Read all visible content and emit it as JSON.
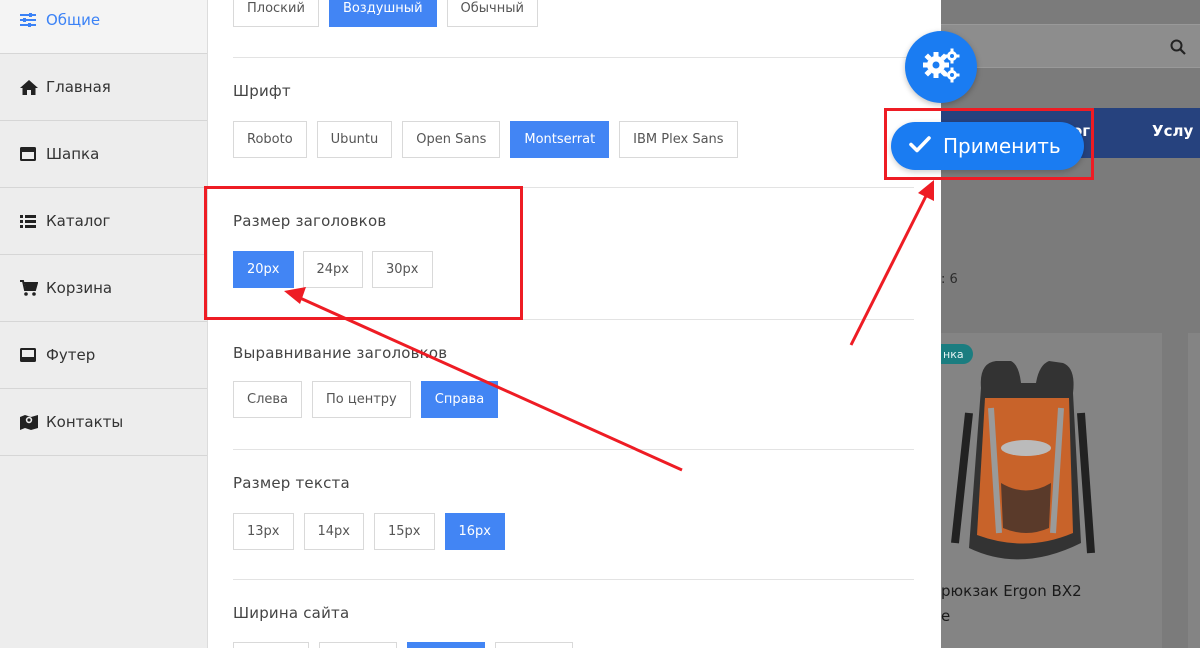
{
  "sidebar": {
    "items": [
      {
        "label": "Общие",
        "icon": "sliders-icon",
        "active": true
      },
      {
        "label": "Главная",
        "icon": "home-icon"
      },
      {
        "label": "Шапка",
        "icon": "header-icon"
      },
      {
        "label": "Каталог",
        "icon": "list-icon"
      },
      {
        "label": "Корзина",
        "icon": "cart-icon"
      },
      {
        "label": "Футер",
        "icon": "footer-icon"
      },
      {
        "label": "Контакты",
        "icon": "map-icon"
      }
    ]
  },
  "panel": {
    "style_options": [
      "Плоский",
      "Воздушный",
      "Обычный"
    ],
    "style_selected": "Воздушный",
    "font": {
      "label": "Шрифт",
      "options": [
        "Roboto",
        "Ubuntu",
        "Open Sans",
        "Montserrat",
        "IBM Plex Sans"
      ],
      "selected": "Montserrat"
    },
    "heading_size": {
      "label": "Размер заголовков",
      "options": [
        "20px",
        "24px",
        "30px"
      ],
      "selected": "20px"
    },
    "heading_align": {
      "label": "Выравнивание заголовков",
      "options": [
        "Слева",
        "По центру",
        "Справа"
      ],
      "selected": "Справа"
    },
    "text_size": {
      "label": "Размер текста",
      "options": [
        "13px",
        "14px",
        "15px",
        "16px"
      ],
      "selected": "16px"
    },
    "site_width": {
      "label": "Ширина сайта"
    }
  },
  "background_page": {
    "nav_links": [
      "лог",
      "Услу"
    ],
    "count_text": ": 6",
    "badge": "нка",
    "product_name_line1": "рюкзак Ergon BX2",
    "product_name_line2": "e"
  },
  "fab": {
    "gear_icon": "gears-icon",
    "apply_label": "Применить"
  },
  "colors": {
    "accent": "#4285f4",
    "fab": "#1a7cf2",
    "annotation": "#ee1c24"
  }
}
